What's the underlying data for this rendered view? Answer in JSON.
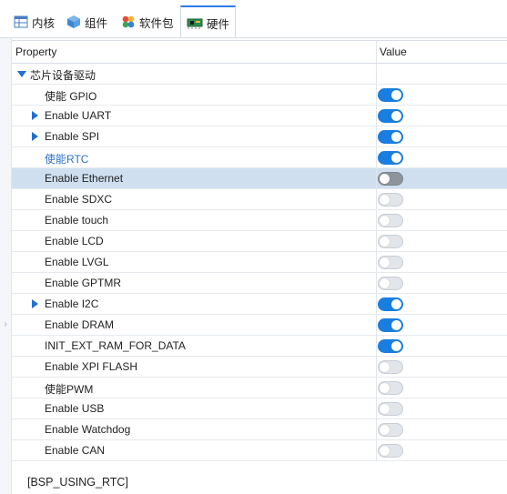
{
  "tabs": [
    {
      "label": "内核",
      "icon": "table-icon"
    },
    {
      "label": "组件",
      "icon": "cube-icon"
    },
    {
      "label": "软件包",
      "icon": "packages-icon"
    },
    {
      "label": "硬件",
      "icon": "board-icon",
      "active": true
    }
  ],
  "table": {
    "col_property": "Property",
    "col_value": "Value",
    "group": "芯片设备驱动",
    "rows": [
      {
        "label": "使能 GPIO",
        "on": true,
        "expand": false
      },
      {
        "label": "Enable UART",
        "on": true,
        "expand": true
      },
      {
        "label": "Enable SPI",
        "on": true,
        "expand": true
      },
      {
        "label": "使能RTC",
        "on": true,
        "expand": false,
        "link": true
      },
      {
        "label": "Enable Ethernet",
        "on": false,
        "expand": false,
        "selected": true
      },
      {
        "label": "Enable SDXC",
        "on": false,
        "expand": false
      },
      {
        "label": "Enable touch",
        "on": false,
        "expand": false
      },
      {
        "label": "Enable LCD",
        "on": false,
        "expand": false
      },
      {
        "label": "Enable LVGL",
        "on": false,
        "expand": false
      },
      {
        "label": "Enable GPTMR",
        "on": false,
        "expand": false
      },
      {
        "label": "Enable I2C",
        "on": true,
        "expand": true
      },
      {
        "label": "Enable DRAM",
        "on": true,
        "expand": false
      },
      {
        "label": "INIT_EXT_RAM_FOR_DATA",
        "on": true,
        "expand": false
      },
      {
        "label": "Enable XPI FLASH",
        "on": false,
        "expand": false
      },
      {
        "label": "使能PWM",
        "on": false,
        "expand": false
      },
      {
        "label": "Enable USB",
        "on": false,
        "expand": false
      },
      {
        "label": "Enable Watchdog",
        "on": false,
        "expand": false
      },
      {
        "label": "Enable CAN",
        "on": false,
        "expand": false
      }
    ]
  },
  "footer": "[BSP_USING_RTC]",
  "colors": {
    "accent": "#1a7de0",
    "selected_row": "#cfdff0",
    "link": "#2a72c8"
  }
}
